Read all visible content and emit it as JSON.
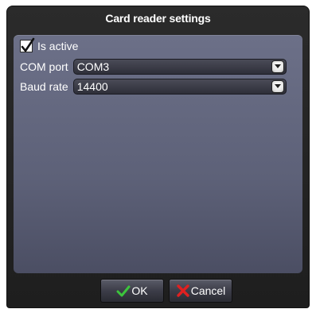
{
  "dialog": {
    "title": "Card reader settings"
  },
  "settings": {
    "is_active_label": "Is active",
    "is_active_checked": true,
    "com_port": {
      "label": "COM port",
      "value": "COM3"
    },
    "baud_rate": {
      "label": "Baud rate",
      "value": "14400"
    }
  },
  "buttons": {
    "ok_label": "OK",
    "cancel_label": "Cancel"
  },
  "icons": {
    "checkmark": "checkmark-icon",
    "dropdown": "chevron-down-icon",
    "ok": "green-check-icon",
    "cancel": "red-x-icon"
  },
  "colors": {
    "ok_icon": "#3cc43c",
    "cancel_icon": "#e02020"
  }
}
